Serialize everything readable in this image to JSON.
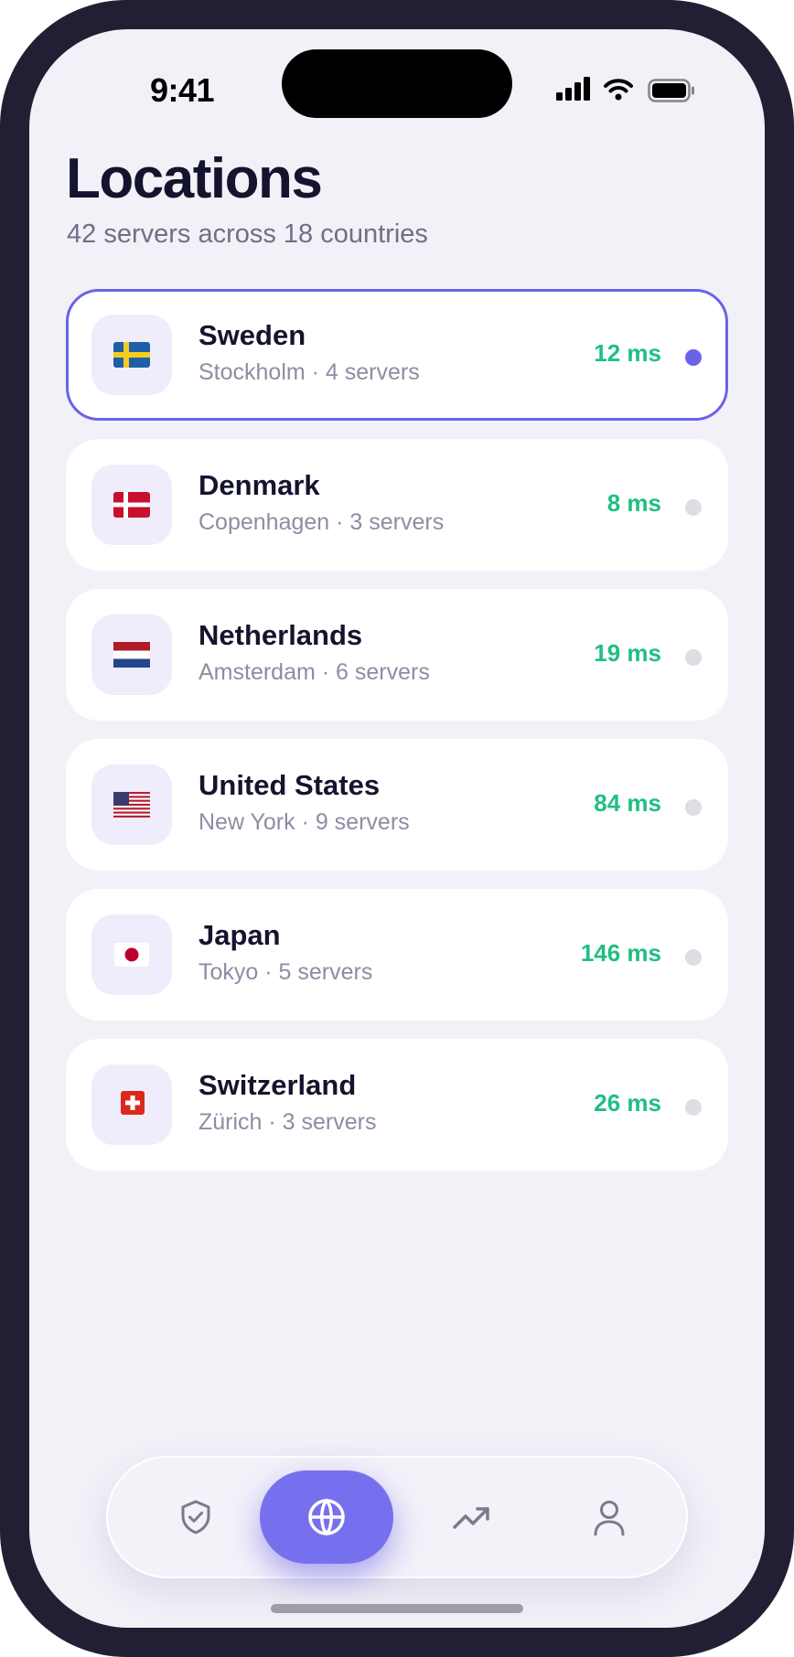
{
  "status_bar": {
    "time": "9:41"
  },
  "header": {
    "title": "Locations",
    "subtitle": "42 servers across 18 countries"
  },
  "locations": [
    {
      "country": "Sweden",
      "city": "Stockholm · 4 servers",
      "latency": "12 ms",
      "flag": "flag-sweden-icon",
      "selected": true
    },
    {
      "country": "Denmark",
      "city": "Copenhagen · 3 servers",
      "latency": "8 ms",
      "flag": "flag-denmark-icon",
      "selected": false
    },
    {
      "country": "Netherlands",
      "city": "Amsterdam · 6 servers",
      "latency": "19 ms",
      "flag": "flag-netherlands-icon",
      "selected": false
    },
    {
      "country": "United States",
      "city": "New York · 9 servers",
      "latency": "84 ms",
      "flag": "flag-united-states-icon",
      "selected": false
    },
    {
      "country": "Japan",
      "city": "Tokyo · 5 servers",
      "latency": "146 ms",
      "flag": "flag-japan-icon",
      "selected": false
    },
    {
      "country": "Switzerland",
      "city": "Zürich · 3 servers",
      "latency": "26 ms",
      "flag": "flag-switzerland-icon",
      "selected": false
    }
  ],
  "tab_bar": {
    "items": [
      {
        "icon": "shield-check-icon",
        "active": false
      },
      {
        "icon": "globe-icon",
        "active": true
      },
      {
        "icon": "trending-up-icon",
        "active": false
      },
      {
        "icon": "user-icon",
        "active": false
      }
    ]
  },
  "colors": {
    "accent": "#6b63e6",
    "latency": "#1fbf82",
    "background": "#f2f1f8",
    "frame": "#221e33"
  }
}
